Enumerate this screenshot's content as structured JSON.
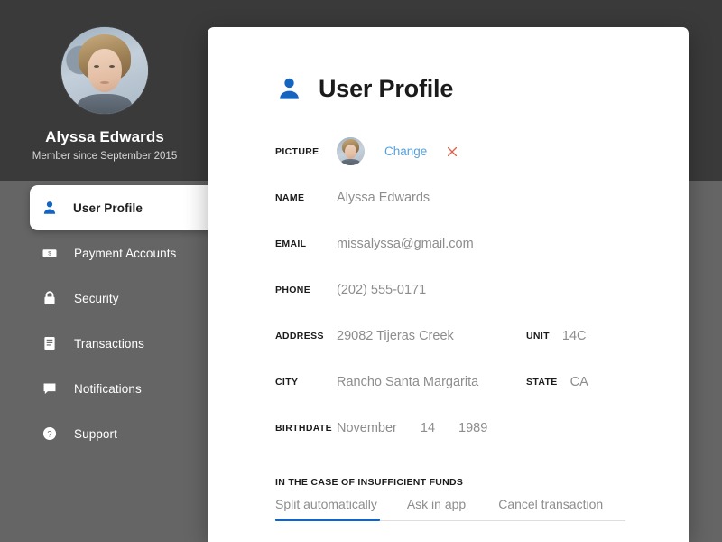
{
  "colors": {
    "accent_blue": "#1565c0",
    "link_blue": "#55a0dd",
    "remove_red": "#e0604c",
    "sidebar_top": "#3a3a3a",
    "sidebar_bottom": "#656565",
    "card_white": "#ffffff",
    "label_dark": "#1b1b1b",
    "value_gray": "#8d8d8d"
  },
  "profile": {
    "avatar_icon": "user-photo",
    "name": "Alyssa Edwards",
    "member_since": "Member since September 2015"
  },
  "sidebar": {
    "items": [
      {
        "label": "User Profile",
        "icon": "person-icon",
        "active": true
      },
      {
        "label": "Payment Accounts",
        "icon": "banknote-icon",
        "active": false
      },
      {
        "label": "Security",
        "icon": "lock-icon",
        "active": false
      },
      {
        "label": "Transactions",
        "icon": "document-icon",
        "active": false
      },
      {
        "label": "Notifications",
        "icon": "speech-bubble-icon",
        "active": false
      },
      {
        "label": "Support",
        "icon": "question-mark-icon",
        "active": false
      }
    ]
  },
  "card": {
    "header": {
      "icon": "person-icon",
      "title": "User Profile"
    },
    "fields": {
      "picture": {
        "label": "PICTURE",
        "thumb_icon": "user-photo-thumbnail",
        "change_label": "Change",
        "remove_icon": "close-x-icon"
      },
      "name": {
        "label": "NAME",
        "value": "Alyssa Edwards"
      },
      "email": {
        "label": "EMAIL",
        "value": "missalyssa@gmail.com"
      },
      "phone": {
        "label": "PHONE",
        "value": "(202) 555-0171"
      },
      "address": {
        "label": "ADDRESS",
        "value": "29082 Tijeras Creek"
      },
      "unit": {
        "label": "UNIT",
        "value": "14C"
      },
      "city": {
        "label": "CITY",
        "value": "Rancho Santa Margarita"
      },
      "state": {
        "label": "STATE",
        "value": "CA"
      },
      "birthdate": {
        "label": "BIRTHDATE",
        "month": "November",
        "day": "14",
        "year": "1989"
      }
    },
    "insufficient_funds": {
      "section_label": "IN THE CASE OF INSUFFICIENT FUNDS",
      "tabs": [
        {
          "label": "Split automatically",
          "active": true
        },
        {
          "label": "Ask in app",
          "active": false
        },
        {
          "label": "Cancel transaction",
          "active": false
        }
      ]
    }
  }
}
